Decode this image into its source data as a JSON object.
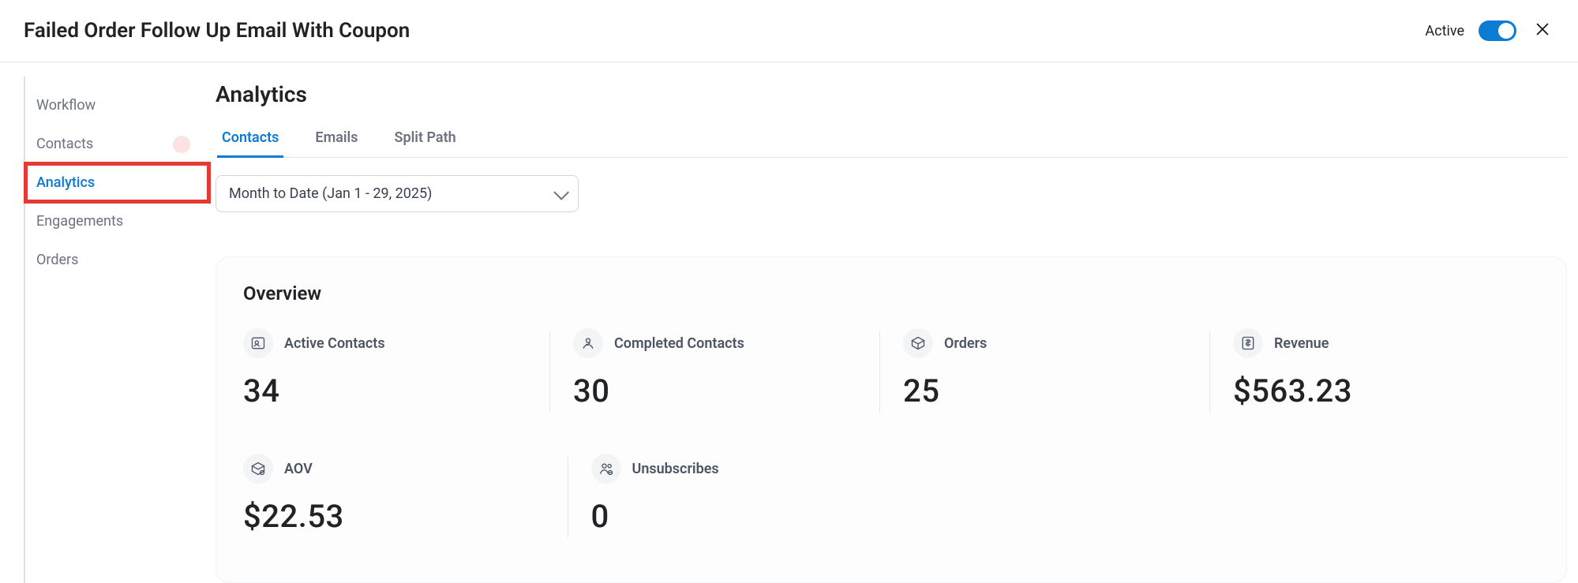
{
  "header": {
    "title": "Failed Order Follow Up Email With Coupon",
    "status_label": "Active",
    "active": true
  },
  "sidebar": {
    "items": [
      {
        "label": "Workflow",
        "active": false
      },
      {
        "label": "Contacts",
        "active": false
      },
      {
        "label": "Analytics",
        "active": true
      },
      {
        "label": "Engagements",
        "active": false
      },
      {
        "label": "Orders",
        "active": false
      }
    ]
  },
  "main": {
    "title": "Analytics",
    "tabs": [
      {
        "label": "Contacts",
        "active": true
      },
      {
        "label": "Emails",
        "active": false
      },
      {
        "label": "Split Path",
        "active": false
      }
    ],
    "date_range": "Month to Date (Jan 1 - 29, 2025)",
    "overview": {
      "title": "Overview",
      "metrics": [
        {
          "label": "Active Contacts",
          "value": "34"
        },
        {
          "label": "Completed Contacts",
          "value": "30"
        },
        {
          "label": "Orders",
          "value": "25"
        },
        {
          "label": "Revenue",
          "value": "$563.23"
        },
        {
          "label": "AOV",
          "value": "$22.53"
        },
        {
          "label": "Unsubscribes",
          "value": "0"
        }
      ]
    }
  }
}
